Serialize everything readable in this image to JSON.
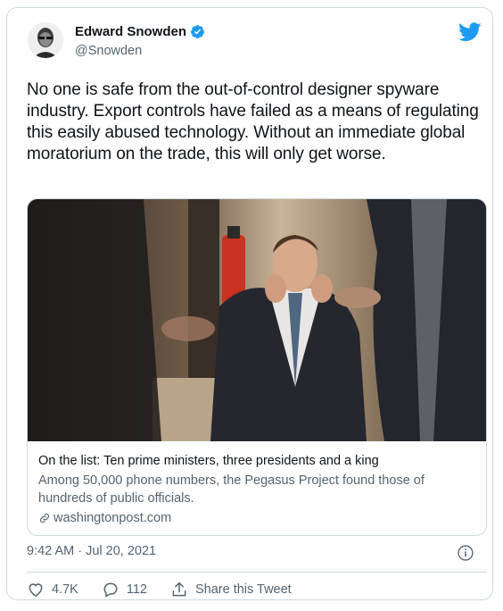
{
  "author": {
    "name": "Edward Snowden",
    "handle": "@Snowden"
  },
  "tweet": {
    "text": "No one is safe from the out-of-control designer spyware industry. Export controls have failed as a means of regulating this easily abused technology. Without an immediate global moratorium on the trade, this will only get worse.",
    "timestamp": "9:42 AM · Jul 20, 2021"
  },
  "card": {
    "title": "On the list: Ten prime ministers, three presidents and a king",
    "description": "Among 50,000 phone numbers, the Pegasus Project found those of hundreds of public officials.",
    "domain": "washingtonpost.com"
  },
  "actions": {
    "likes": "4.7K",
    "replies": "112",
    "share_label": "Share this Tweet"
  },
  "colors": {
    "twitter_blue": "#1d9bf0",
    "text_primary": "#0f1419",
    "text_secondary": "#536471",
    "border": "#cfd9de"
  }
}
